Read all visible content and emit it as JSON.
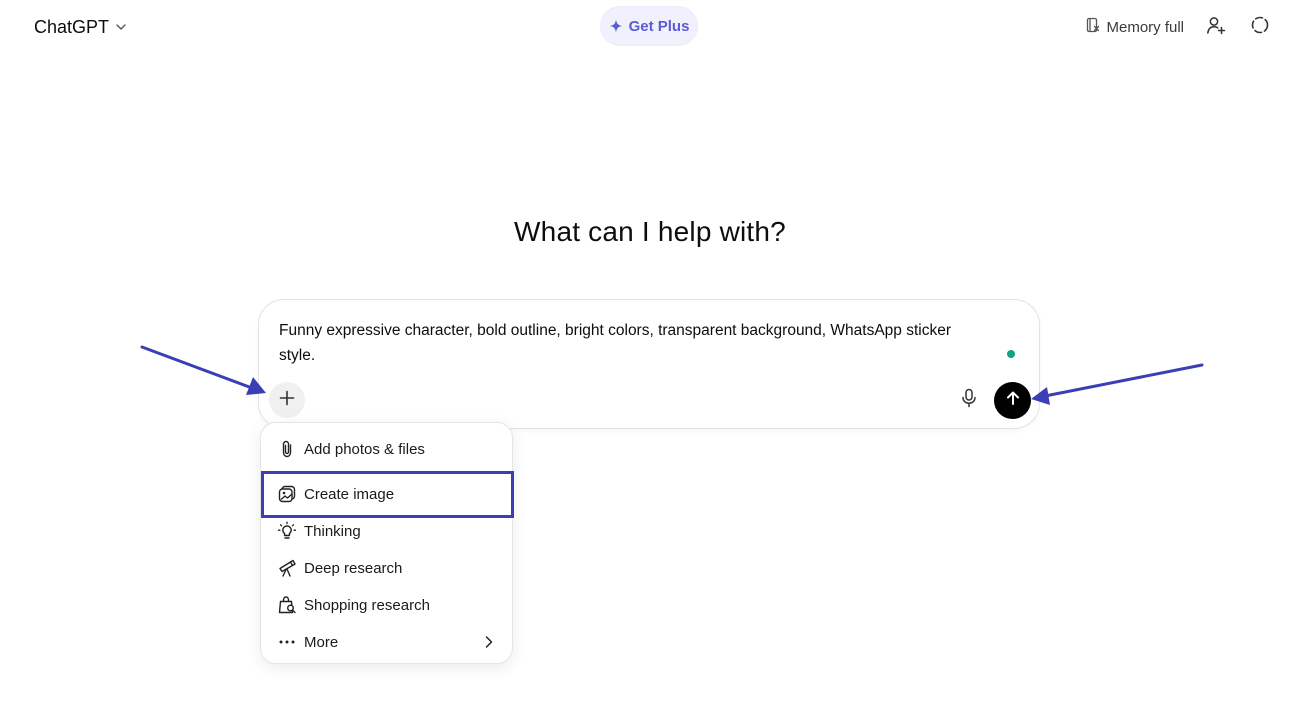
{
  "header": {
    "model_name": "ChatGPT",
    "get_plus_label": "Get Plus",
    "memory_label": "Memory full"
  },
  "main": {
    "heading": "What can I help with?"
  },
  "composer": {
    "prompt_line1": "Funny expressive character, bold outline, bright colors, transparent background, WhatsApp sticker",
    "prompt_line2": "style."
  },
  "menu": {
    "items": [
      {
        "label": "Add photos & files",
        "icon": "paperclip-icon"
      },
      {
        "label": "Create image",
        "icon": "image-create-icon"
      },
      {
        "label": "Thinking",
        "icon": "lightbulb-icon"
      },
      {
        "label": "Deep research",
        "icon": "telescope-icon"
      },
      {
        "label": "Shopping research",
        "icon": "shopping-bag-icon"
      },
      {
        "label": "More",
        "icon": "ellipsis-icon"
      }
    ]
  },
  "colors": {
    "accent": "#5b5bd6",
    "annotation": "#3b3fb5",
    "status_dot": "#10a37f"
  }
}
